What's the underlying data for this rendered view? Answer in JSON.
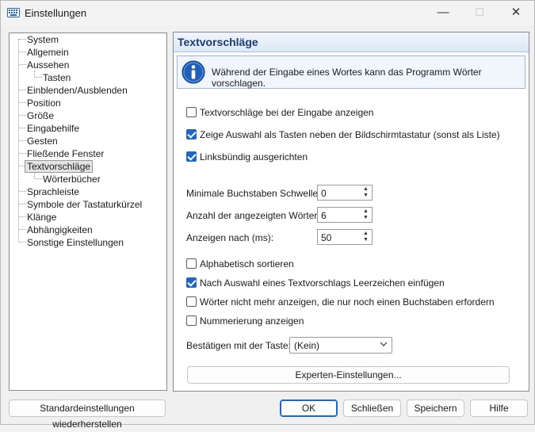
{
  "window": {
    "title": "Einstellungen",
    "minimize": "—",
    "maximize": "☐",
    "close": "✕"
  },
  "tree": {
    "items": [
      {
        "label": "System"
      },
      {
        "label": "Allgemein"
      },
      {
        "label": "Aussehen"
      },
      {
        "label": "Tasten"
      },
      {
        "label": "Einblenden/Ausblenden"
      },
      {
        "label": "Position"
      },
      {
        "label": "Größe"
      },
      {
        "label": "Eingabehilfe"
      },
      {
        "label": "Gesten"
      },
      {
        "label": "Fließende Fenster"
      },
      {
        "label": "Textvorschläge",
        "selected": true
      },
      {
        "label": "Wörterbücher"
      },
      {
        "label": "Sprachleiste"
      },
      {
        "label": "Symbole der Tastaturkürzel"
      },
      {
        "label": "Klänge"
      },
      {
        "label": "Abhängigkeiten"
      },
      {
        "label": "Sonstige Einstellungen"
      }
    ]
  },
  "panel": {
    "title": "Textvorschläge",
    "info": "Während der Eingabe eines Wortes kann das Programm Wörter vorschlagen.",
    "checkboxes": [
      {
        "label": "Textvorschläge bei der Eingabe anzeigen",
        "checked": false
      },
      {
        "label": "Zeige Auswahl als Tasten neben der Bildschirmtastatur (sonst als Liste)",
        "checked": true
      },
      {
        "label": "Linksbündig ausgerichten",
        "checked": true
      }
    ],
    "spinners": [
      {
        "label": "Minimale Buchstaben Schwelle:",
        "value": "0"
      },
      {
        "label": "Anzahl der angezeigten Wörter:",
        "value": "6"
      },
      {
        "label": "Anzeigen nach (ms):",
        "value": "50"
      }
    ],
    "checkboxes2": [
      {
        "label": "Alphabetisch sortieren",
        "checked": false
      },
      {
        "label": "Nach Auswahl eines Textvorschlags Leerzeichen einfügen",
        "checked": true
      },
      {
        "label": "Wörter nicht mehr anzeigen, die nur noch einen Buchstaben erfordern",
        "checked": false
      },
      {
        "label": "Nummerierung anzeigen",
        "checked": false
      }
    ],
    "confirm_label": "Bestätigen mit der Taste:",
    "confirm_value": "(Kein)",
    "expert_button": "Experten-Einstellungen..."
  },
  "buttons": {
    "restore": "Standardeinstellungen wiederherstellen",
    "ok": "OK",
    "close": "Schließen",
    "save": "Speichern",
    "help": "Hilfe"
  },
  "colors": {
    "accent": "#1f66c5",
    "header_text": "#1c3c70"
  }
}
